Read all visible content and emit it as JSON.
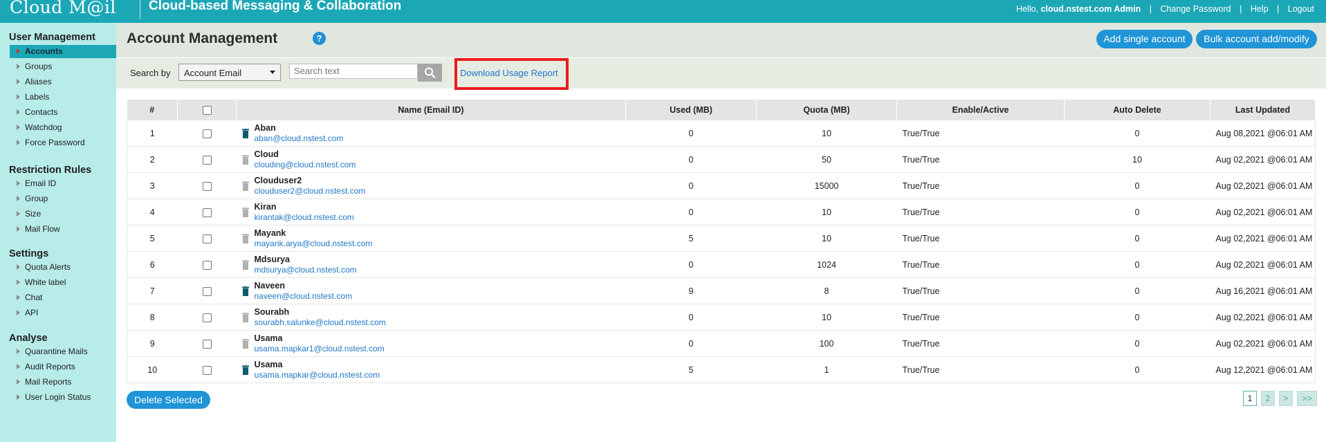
{
  "header": {
    "logo": "Cloud M@il",
    "tagline": "Cloud-based Messaging & Collaboration",
    "greeting": "Hello,",
    "user": "cloud.nstest.com Admin",
    "links": [
      "Change Password",
      "Help",
      "Logout"
    ]
  },
  "sidebar": {
    "sections": [
      {
        "title": "User Management",
        "items": [
          "Accounts",
          "Groups",
          "Aliases",
          "Labels",
          "Contacts",
          "Watchdog",
          "Force Password"
        ]
      },
      {
        "title": "Restriction Rules",
        "items": [
          "Email ID",
          "Group",
          "Size",
          "Mail Flow"
        ]
      },
      {
        "title": "Settings",
        "items": [
          "Quota Alerts",
          "White label",
          "Chat",
          "API"
        ]
      },
      {
        "title": "Analyse",
        "items": [
          "Quarantine Mails",
          "Audit Reports",
          "Mail Reports",
          "User Login Status"
        ]
      }
    ],
    "active_item": "Accounts"
  },
  "main": {
    "title": "Account Management",
    "help_icon_text": "?",
    "add_single_label": "Add single account",
    "bulk_label": "Bulk account add/modify",
    "search_by_label": "Search by",
    "search_select_value": "Account Email",
    "search_placeholder": "Search text",
    "download_label": "Download Usage Report",
    "delete_label": "Delete Selected"
  },
  "table": {
    "columns": [
      "#",
      "",
      "Name (Email ID)",
      "Used (MB)",
      "Quota (MB)",
      "Enable/Active",
      "Auto Delete",
      "Last Updated"
    ],
    "rows": [
      {
        "n": "1",
        "name": "Aban",
        "email": "aban@cloud.nstest.com",
        "used": "0",
        "quota": "10",
        "status": "True/True",
        "auto": "0",
        "updated": "Aug 08,2021 @06:01 AM",
        "icon": "dark"
      },
      {
        "n": "2",
        "name": "Cloud",
        "email": "clouding@cloud.nstest.com",
        "used": "0",
        "quota": "50",
        "status": "True/True",
        "auto": "10",
        "updated": "Aug 02,2021 @06:01 AM",
        "icon": "light"
      },
      {
        "n": "3",
        "name": "Clouduser2",
        "email": "clouduser2@cloud.nstest.com",
        "used": "0",
        "quota": "15000",
        "status": "True/True",
        "auto": "0",
        "updated": "Aug 02,2021 @06:01 AM",
        "icon": "light"
      },
      {
        "n": "4",
        "name": "Kiran",
        "email": "kirantak@cloud.nstest.com",
        "used": "0",
        "quota": "10",
        "status": "True/True",
        "auto": "0",
        "updated": "Aug 02,2021 @06:01 AM",
        "icon": "light"
      },
      {
        "n": "5",
        "name": "Mayank",
        "email": "mayank.arya@cloud.nstest.com",
        "used": "5",
        "quota": "10",
        "status": "True/True",
        "auto": "0",
        "updated": "Aug 02,2021 @06:01 AM",
        "icon": "light"
      },
      {
        "n": "6",
        "name": "Mdsurya",
        "email": "mdsurya@cloud.nstest.com",
        "used": "0",
        "quota": "1024",
        "status": "True/True",
        "auto": "0",
        "updated": "Aug 02,2021 @06:01 AM",
        "icon": "light"
      },
      {
        "n": "7",
        "name": "Naveen",
        "email": "naveen@cloud.nstest.com",
        "used": "9",
        "quota": "8",
        "status": "True/True",
        "auto": "0",
        "updated": "Aug 16,2021 @06:01 AM",
        "icon": "dark"
      },
      {
        "n": "8",
        "name": "Sourabh",
        "email": "sourabh.salunke@cloud.nstest.com",
        "used": "0",
        "quota": "10",
        "status": "True/True",
        "auto": "0",
        "updated": "Aug 02,2021 @06:01 AM",
        "icon": "light"
      },
      {
        "n": "9",
        "name": "Usama",
        "email": "usama.mapkar1@cloud.nstest.com",
        "used": "0",
        "quota": "100",
        "status": "True/True",
        "auto": "0",
        "updated": "Aug 02,2021 @06:01 AM",
        "icon": "light"
      },
      {
        "n": "10",
        "name": "Usama",
        "email": "usama.mapkar@cloud.nstest.com",
        "used": "5",
        "quota": "1",
        "status": "True/True",
        "auto": "0",
        "updated": "Aug 12,2021 @06:01 AM",
        "icon": "dark"
      }
    ]
  },
  "pagination": [
    "1",
    "2",
    ">",
    ">>"
  ],
  "colors": {
    "brand": "#1ca7b6",
    "button": "#1f94d7",
    "link": "#1f77c9",
    "highlight": "#ea1c1c"
  }
}
